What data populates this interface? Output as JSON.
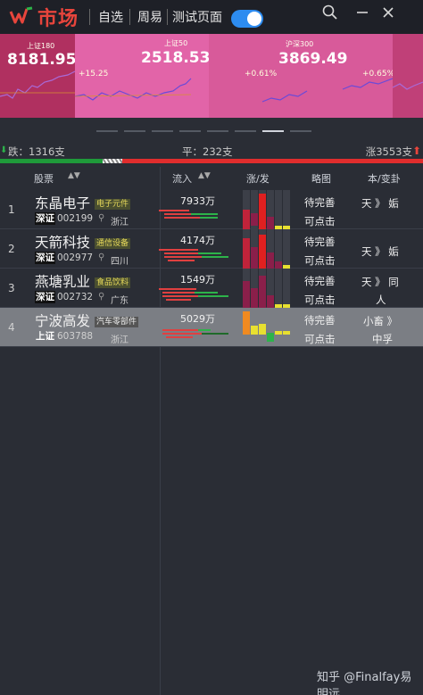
{
  "header": {
    "app_title": "市场",
    "nav": [
      "自选",
      "周易",
      "测试页面"
    ],
    "toggle_on": true
  },
  "indices": [
    {
      "name": "上证180",
      "value": "8181.95",
      "change": "+15.25"
    },
    {
      "name": "上证50",
      "value": "2518.53",
      "change": "+0.61%"
    },
    {
      "name": "沪深300",
      "value": "3869.49",
      "change": "+0.65%"
    }
  ],
  "pager": {
    "count": 8,
    "active": 6
  },
  "breadth": {
    "down_label": "跌：1316支",
    "flat_label": "平：232支",
    "up_label": "涨3553支",
    "down": 1316,
    "flat": 232,
    "up": 3553
  },
  "table": {
    "headers": [
      "股票",
      "流入",
      "涨/发",
      "略图",
      "本/变卦"
    ],
    "rows": [
      {
        "rank": "1",
        "name": "东晶电子",
        "sector": "电子元件",
        "market": "深证",
        "code": "002199",
        "region": "浙江",
        "flow": "7933万",
        "status1": "待完善",
        "status2": "可点击",
        "ben1": "天 》 姤",
        "ben2": ""
      },
      {
        "rank": "2",
        "name": "天箭科技",
        "sector": "通信设备",
        "market": "深证",
        "code": "002977",
        "region": "四川",
        "flow": "4174万",
        "status1": "待完善",
        "status2": "可点击",
        "ben1": "天 》 姤",
        "ben2": ""
      },
      {
        "rank": "3",
        "name": "燕塘乳业",
        "sector": "食品饮料",
        "market": "深证",
        "code": "002732",
        "region": "广东",
        "flow": "1549万",
        "status1": "待完善",
        "status2": "可点击",
        "ben1": "天 》 同",
        "ben2": "人"
      },
      {
        "rank": "4",
        "name": "宁波高发",
        "sector": "汽车零部件",
        "market": "上证",
        "code": "603788",
        "region": "浙江",
        "flow": "5029万",
        "status1": "待完善",
        "status2": "可点击",
        "ben1": "小畜 》",
        "ben2": "中孚"
      }
    ]
  },
  "watermark": "知乎 @Finalfay易明远",
  "colors": {
    "accent_red": "#e8453c",
    "up_red": "#e02d2d",
    "down_green": "#1f9a3a",
    "toggle_blue": "#2d8cf0",
    "index_pink": "#e060a0"
  },
  "icons": [
    "logo-icon",
    "search-icon",
    "minimize-icon",
    "close-icon",
    "location-pin-icon",
    "arrow-down-icon",
    "arrow-up-icon"
  ]
}
